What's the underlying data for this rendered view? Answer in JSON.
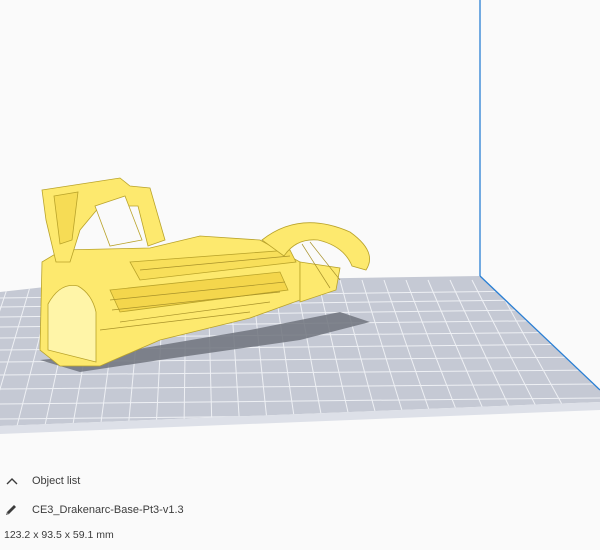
{
  "colors": {
    "background": "#fafafa",
    "build_plate": "#c7cbd6",
    "grid_lines": "#ffffff",
    "model": "#fde96e",
    "build_volume_edge": "#2a7fd4",
    "plate_front_edge": "#d9dde6"
  },
  "icons": {
    "collapse": "chevron-up-icon",
    "edit": "pencil-icon"
  },
  "object_list": {
    "toggle_label": "Object list",
    "object_name": "CE3_Drakenarc-Base-Pt3-v1.3",
    "dimensions": "123.2 x 93.5 x 59.1 mm"
  }
}
